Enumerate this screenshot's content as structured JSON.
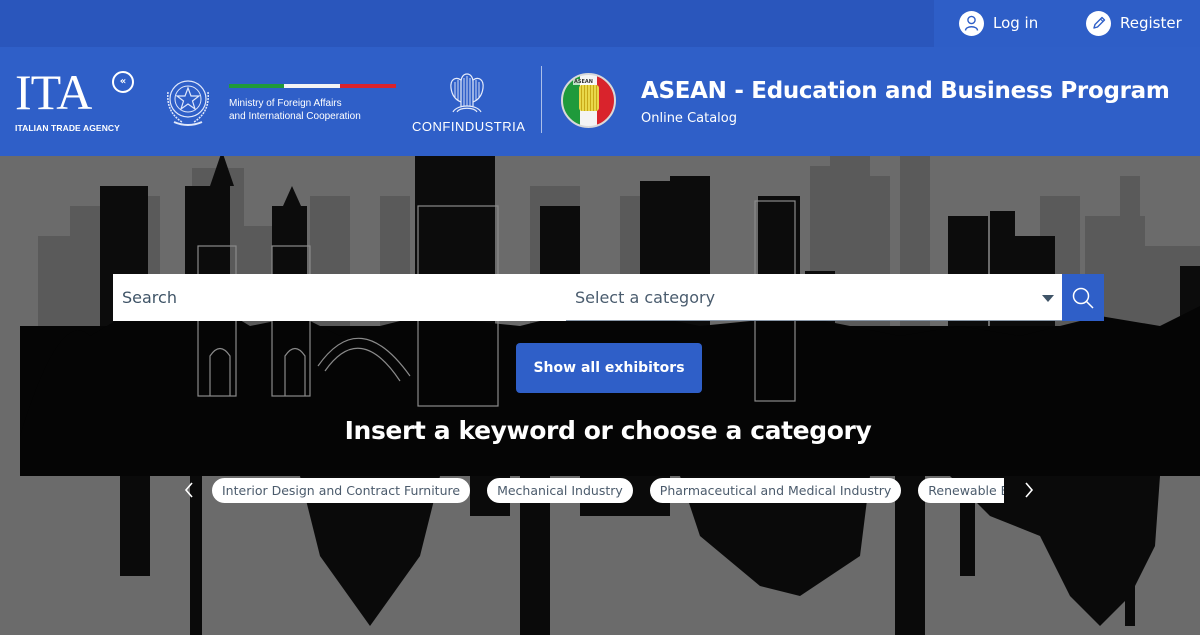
{
  "topbar": {
    "login_label": "Log in",
    "register_label": "Register",
    "login_icon": "user-icon",
    "register_icon": "pencil-icon"
  },
  "header": {
    "ita": {
      "logo_text": "ITA",
      "subtitle": "ITALIAN TRADE AGENCY"
    },
    "ministry": {
      "line1": "Ministry of Foreign Affairs",
      "line2": "and International Cooperation"
    },
    "confindustria": "CONFINDUSTRIA",
    "asean_badge_label": "ASEAN",
    "title": "ASEAN - Education and Business Program",
    "subtitle": "Online Catalog",
    "colors": {
      "brand_blue": "#2f5fc8",
      "flag_green": "#1f9a3b",
      "flag_white": "#f4f4f4",
      "flag_red": "#d9232c"
    }
  },
  "search": {
    "input_placeholder": "Search",
    "input_value": "",
    "category_selected": "Select a category",
    "search_icon": "search-icon"
  },
  "show_all_label": "Show all exhibitors",
  "hero_heading": "Insert a keyword or choose a category",
  "categories": [
    "Interior Design and Contract Furniture",
    "Mechanical Industry",
    "Pharmaceutical and Medical Industry",
    "Renewable Energy"
  ]
}
